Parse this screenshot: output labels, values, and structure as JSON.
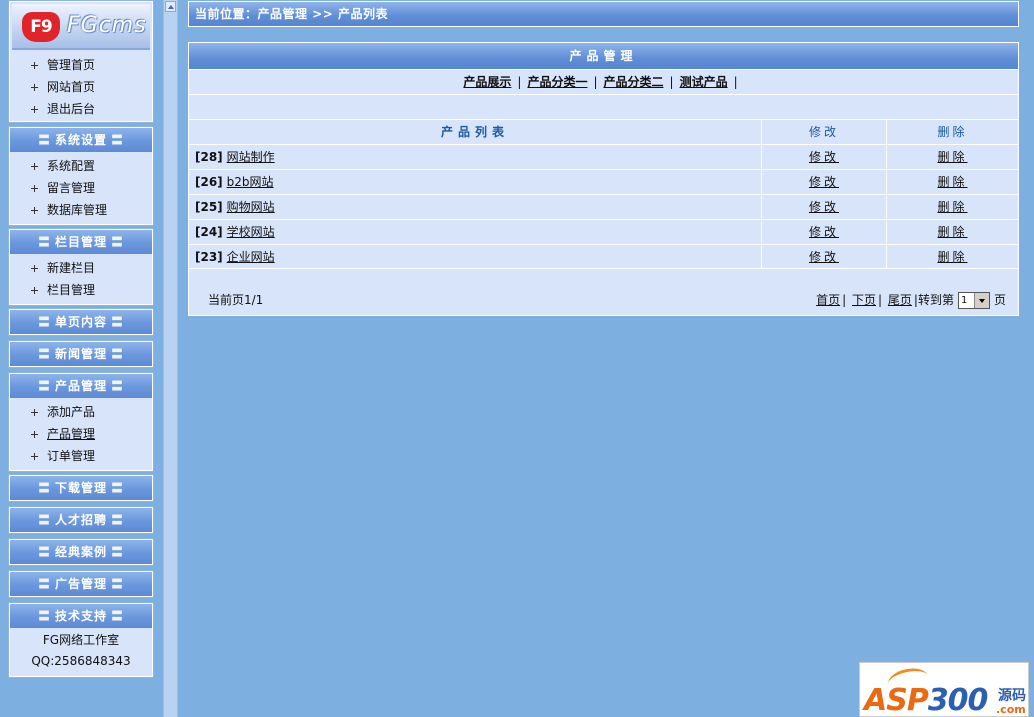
{
  "logo": {
    "mark": "F9",
    "word": "FGcms"
  },
  "top_menu": [
    {
      "label": "管理首页"
    },
    {
      "label": "网站首页"
    },
    {
      "label": "退出后台"
    }
  ],
  "sections": [
    {
      "title": "系统设置",
      "items": [
        "系统配置",
        "留言管理",
        "数据库管理"
      ]
    },
    {
      "title": "栏目管理",
      "items": [
        "新建栏目",
        "栏目管理"
      ]
    },
    {
      "title": "单页内容",
      "items": []
    },
    {
      "title": "新闻管理",
      "items": []
    },
    {
      "title": "产品管理",
      "items": [
        "添加产品",
        "产品管理",
        "订单管理"
      ]
    },
    {
      "title": "下载管理",
      "items": []
    },
    {
      "title": "人才招聘",
      "items": []
    },
    {
      "title": "经典案例",
      "items": []
    },
    {
      "title": "广告管理",
      "items": []
    }
  ],
  "support": {
    "title": "技术支持",
    "lines": [
      "FG网络工作室",
      "QQ:2586848343"
    ]
  },
  "breadcrumb": "当前位置：产品管理 >> 产品列表",
  "main": {
    "title": "产品管理",
    "tabs": [
      "产品展示",
      "产品分类一",
      "产品分类二",
      "测试产品"
    ],
    "table": {
      "headers": [
        "产品列表",
        "修改",
        "删除"
      ],
      "rows": [
        {
          "id": "[28]",
          "name": "网站制作",
          "edit": "修改",
          "delete": "删除"
        },
        {
          "id": "[26]",
          "name": "b2b网站",
          "edit": "修改",
          "delete": "删除"
        },
        {
          "id": "[25]",
          "name": "购物网站",
          "edit": "修改",
          "delete": "删除"
        },
        {
          "id": "[24]",
          "name": "学校网站",
          "edit": "修改",
          "delete": "删除"
        },
        {
          "id": "[23]",
          "name": "企业网站",
          "edit": "修改",
          "delete": "删除"
        }
      ]
    },
    "pager": {
      "current": "当前页1/1",
      "first": "首页",
      "next": "下页",
      "last": "尾页",
      "goto": "转到第",
      "page_value": "1",
      "page_suffix": "页"
    }
  },
  "watermark": {
    "brand": "ASP",
    "num": "300",
    "yuanma": "源码",
    "com": ".com"
  },
  "colors": {
    "background": "#7db0e1",
    "panel": "#d8e4fa",
    "header_blue": "#5f8dd6",
    "link_blue": "#1c5aa3"
  }
}
